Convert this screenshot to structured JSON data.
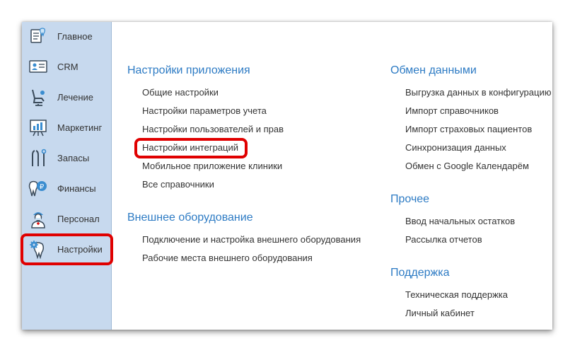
{
  "sidebar": {
    "items": [
      {
        "label": "Главное",
        "icon": "tooth-checklist-icon"
      },
      {
        "label": "CRM",
        "icon": "contact-card-icon"
      },
      {
        "label": "Лечение",
        "icon": "dental-chair-icon"
      },
      {
        "label": "Маркетинг",
        "icon": "chart-board-icon"
      },
      {
        "label": "Запасы",
        "icon": "dental-tools-icon"
      },
      {
        "label": "Финансы",
        "icon": "tooth-coin-icon"
      },
      {
        "label": "Персонал",
        "icon": "doctor-icon"
      },
      {
        "label": "Настройки",
        "icon": "tooth-gear-icon"
      }
    ],
    "active_index": 7
  },
  "sections": {
    "app_settings": {
      "title": "Настройки приложения",
      "links": [
        "Общие настройки",
        "Настройки параметров учета",
        "Настройки пользователей и прав",
        "Настройки интеграций",
        "Мобильное приложение клиники",
        "Все справочники"
      ]
    },
    "external_equipment": {
      "title": "Внешнее оборудование",
      "links": [
        "Подключение и настройка внешнего оборудования",
        "Рабочие места внешнего оборудования"
      ]
    },
    "data_exchange": {
      "title": "Обмен данными",
      "links": [
        "Выгрузка данных в конфигурацию",
        "Импорт справочников",
        "Импорт страховых пациентов",
        "Синхронизация данных",
        "Обмен с Google Календарём"
      ]
    },
    "other": {
      "title": "Прочее",
      "links": [
        "Ввод начальных остатков",
        "Рассылка отчетов"
      ]
    },
    "support": {
      "title": "Поддержка",
      "links": [
        "Техническая поддержка",
        "Личный кабинет"
      ]
    }
  },
  "colors": {
    "sidebar_bg": "#c7d9ee",
    "section_title": "#2d7bc4",
    "highlight": "#e00000",
    "icon_blue": "#3a8dd0",
    "icon_dark": "#3a4a5a"
  }
}
